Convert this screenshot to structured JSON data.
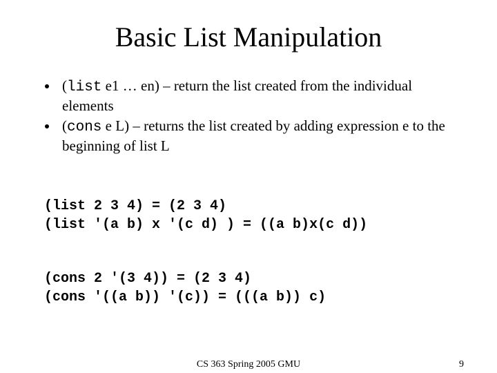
{
  "title": "Basic List Manipulation",
  "bullets": [
    {
      "code": "list",
      "sig": " e1 … en)",
      "desc": " – return the list created from the individual elements"
    },
    {
      "code": "cons",
      "sig": " e L)",
      "desc": " – returns the list created by adding expression e to the beginning of list L"
    }
  ],
  "examples": {
    "l1": "(list 2 3 4) = (2 3 4)",
    "l2": "(list '(a b) x '(c d) ) = ((a b)x(c d))",
    "l3": "(cons 2 '(3 4)) = (2 3 4)",
    "l4": "(cons '((a b)) '(c)) = (((a b)) c)"
  },
  "footer": {
    "center": "CS 363 Spring 2005 GMU",
    "page": "9"
  }
}
